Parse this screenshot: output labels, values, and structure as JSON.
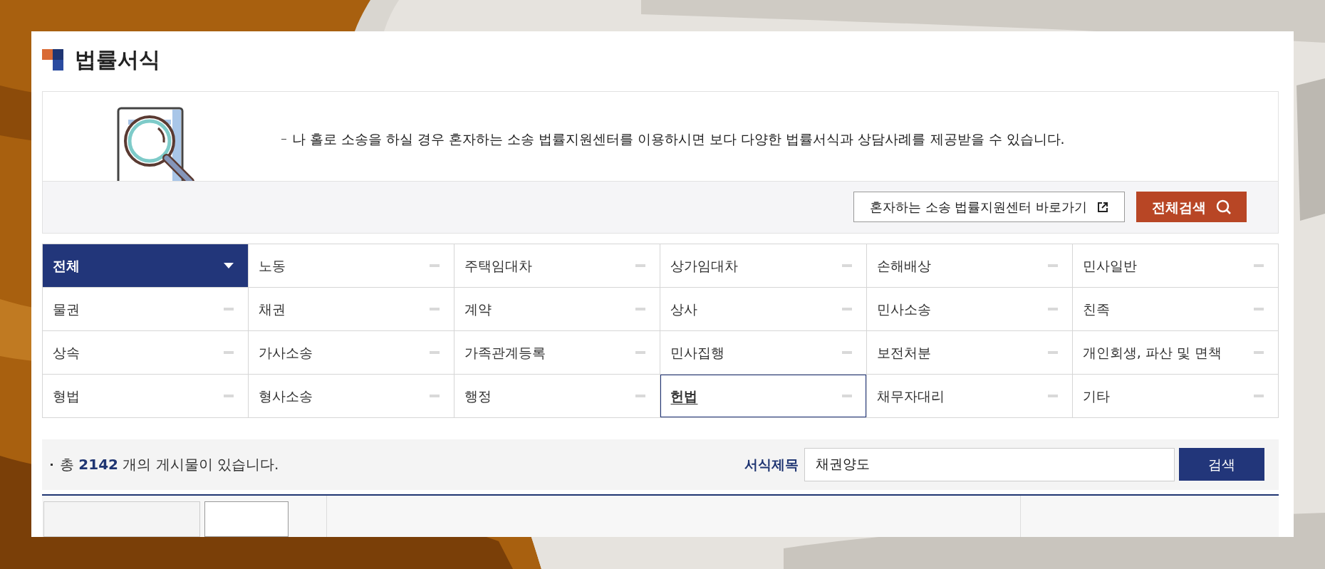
{
  "page_title": "법률서식",
  "notice": {
    "text": "나 홀로 소송을 하실 경우 혼자하는 소송 법률지원센터를 이용하시면 보다 다양한 법률서식과 상담사례를 제공받을 수 있습니다."
  },
  "buttons": [
    {
      "label": "혼자하는 소송 법률지원센터 바로가기",
      "kind": "link"
    },
    {
      "label": "전체검색",
      "kind": "search"
    }
  ],
  "categories": [
    {
      "label": "전체",
      "selected": true,
      "focused": false
    },
    {
      "label": "노동",
      "selected": false,
      "focused": false
    },
    {
      "label": "주택임대차",
      "selected": false,
      "focused": false
    },
    {
      "label": "상가임대차",
      "selected": false,
      "focused": false
    },
    {
      "label": "손해배상",
      "selected": false,
      "focused": false
    },
    {
      "label": "민사일반",
      "selected": false,
      "focused": false
    },
    {
      "label": "물권",
      "selected": false,
      "focused": false
    },
    {
      "label": "채권",
      "selected": false,
      "focused": false
    },
    {
      "label": "계약",
      "selected": false,
      "focused": false
    },
    {
      "label": "상사",
      "selected": false,
      "focused": false
    },
    {
      "label": "민사소송",
      "selected": false,
      "focused": false
    },
    {
      "label": "친족",
      "selected": false,
      "focused": false
    },
    {
      "label": "상속",
      "selected": false,
      "focused": false
    },
    {
      "label": "가사소송",
      "selected": false,
      "focused": false
    },
    {
      "label": "가족관계등록",
      "selected": false,
      "focused": false
    },
    {
      "label": "민사집행",
      "selected": false,
      "focused": false
    },
    {
      "label": "보전처분",
      "selected": false,
      "focused": false
    },
    {
      "label": "개인회생, 파산 및 면책",
      "selected": false,
      "focused": false
    },
    {
      "label": "형법",
      "selected": false,
      "focused": false
    },
    {
      "label": "형사소송",
      "selected": false,
      "focused": false
    },
    {
      "label": "행정",
      "selected": false,
      "focused": false
    },
    {
      "label": "헌법",
      "selected": false,
      "focused": true
    },
    {
      "label": "채무자대리",
      "selected": false,
      "focused": false
    },
    {
      "label": "기타",
      "selected": false,
      "focused": false
    }
  ],
  "result_count": "총 **2142** 개의 게시물이 있습니다.",
  "search": {
    "label": "서식제목",
    "value": "채권양도",
    "button": "검색"
  }
}
